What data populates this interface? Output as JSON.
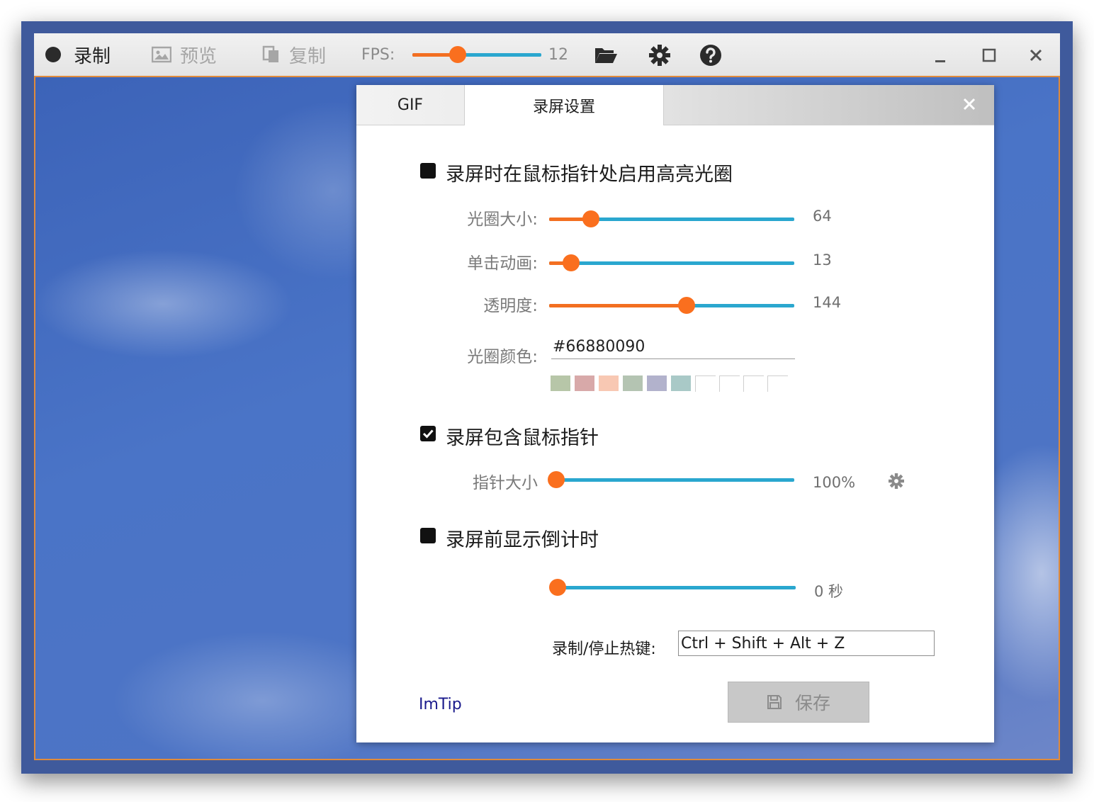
{
  "toolbar": {
    "record_label": "录制",
    "preview_label": "预览",
    "copy_label": "复制",
    "fps_label": "FPS:",
    "fps_value": "12",
    "fps_fraction": 0.35
  },
  "dialog": {
    "tabs": [
      {
        "label": "GIF",
        "active": false
      },
      {
        "label": "录屏设置",
        "active": true
      }
    ],
    "highlight": {
      "checkbox_label": "录屏时在鼠标指针处启用高亮光圈",
      "checked": false,
      "size": {
        "label": "光圈大小:",
        "value": "64",
        "fraction": 0.17
      },
      "click_anim": {
        "label": "单击动画:",
        "value": "13",
        "fraction": 0.09
      },
      "opacity": {
        "label": "透明度:",
        "value": "144",
        "fraction": 0.56
      },
      "color": {
        "label": "光圈颜色:",
        "value": "#66880090"
      },
      "swatches": [
        "#b7c6a8",
        "#d8a9a9",
        "#f8c8b3",
        "#b4c4b2",
        "#b2b2cc",
        "#a9c9c7",
        "",
        "",
        "",
        ""
      ]
    },
    "cursor": {
      "checkbox_label": "录屏包含鼠标指针",
      "checked": true,
      "size": {
        "label": "指针大小",
        "value": "100%",
        "fraction": 0.0
      }
    },
    "countdown": {
      "checkbox_label": "录屏前显示倒计时",
      "checked": false,
      "value": "0 秒",
      "fraction": 0.0
    },
    "hotkey": {
      "label": "录制/停止热键:",
      "value": "Ctrl + Shift + Alt + Z"
    },
    "link_label": "ImTip",
    "save_label": "保存"
  },
  "colors": {
    "accent": "#f36f21",
    "track": "#2aa7cf"
  }
}
